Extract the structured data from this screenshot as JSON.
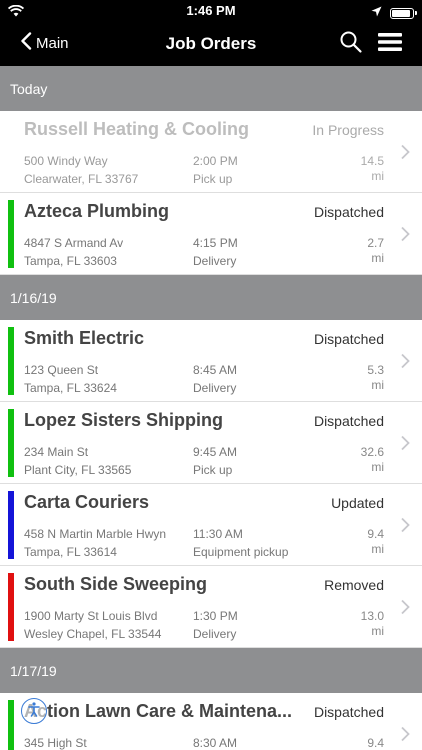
{
  "status_bar": {
    "time": "1:46 PM"
  },
  "nav": {
    "back_label": "Main",
    "title": "Job Orders"
  },
  "sections": [
    {
      "title": "Today",
      "rows": [
        {
          "name": "Russell Heating & Cooling",
          "status": "In Progress",
          "addr1": "500 Windy Way",
          "addr2": "Clearwater, FL 33767",
          "time": "2:00 PM",
          "kind": "Pick up",
          "dist": "14.5",
          "unit": "mi",
          "color": "",
          "faded": true
        },
        {
          "name": "Azteca Plumbing",
          "status": "Dispatched",
          "addr1": "4847 S Armand Av",
          "addr2": "Tampa, FL 33603",
          "time": "4:15 PM",
          "kind": "Delivery",
          "dist": "2.7",
          "unit": "mi",
          "color": "#10c010",
          "faded": false
        }
      ]
    },
    {
      "title": "1/16/19",
      "rows": [
        {
          "name": "Smith Electric",
          "status": "Dispatched",
          "addr1": "123 Queen St",
          "addr2": "Tampa, FL 33624",
          "time": "8:45 AM",
          "kind": "Delivery",
          "dist": "5.3",
          "unit": "mi",
          "color": "#10c010",
          "faded": false
        },
        {
          "name": "Lopez Sisters Shipping",
          "status": "Dispatched",
          "addr1": "234 Main St",
          "addr2": "Plant City, FL 33565",
          "time": "9:45 AM",
          "kind": "Pick up",
          "dist": "32.6",
          "unit": "mi",
          "color": "#10c010",
          "faded": false
        },
        {
          "name": "Carta Couriers",
          "status": "Updated",
          "addr1": "458 N Martin Marble Hwyn",
          "addr2": "Tampa, FL 33614",
          "time": "11:30 AM",
          "kind": "Equipment pickup",
          "dist": "9.4",
          "unit": "mi",
          "color": "#1414d8",
          "faded": false
        },
        {
          "name": "South Side Sweeping",
          "status": "Removed",
          "addr1": "1900 Marty St Louis Blvd",
          "addr2": "Wesley Chapel, FL 33544",
          "time": "1:30 PM",
          "kind": "Delivery",
          "dist": "13.0",
          "unit": "mi",
          "color": "#e01010",
          "faded": false
        }
      ]
    },
    {
      "title": "1/17/19",
      "rows": [
        {
          "name": "Action Lawn Care & Maintena...",
          "status": "Dispatched",
          "addr1": "345 High St",
          "addr2": "",
          "time": "8:30 AM",
          "kind": "",
          "dist": "9.4",
          "unit": "",
          "color": "#10c010",
          "faded": false
        }
      ]
    }
  ]
}
